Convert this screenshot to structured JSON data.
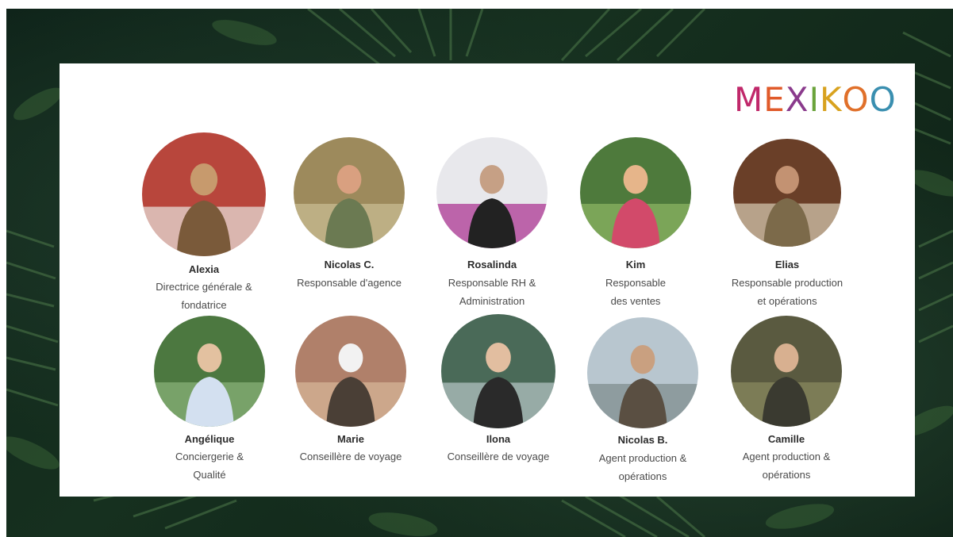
{
  "brand": {
    "logo_text": "MEXIKOO",
    "letters": [
      {
        "ch": "M",
        "color": "#c0286a"
      },
      {
        "ch": "E",
        "color": "#e05a2a"
      },
      {
        "ch": "X",
        "color": "#8a3a8c"
      },
      {
        "ch": "I",
        "color": "#6aa33a"
      },
      {
        "ch": "K",
        "color": "#d8a21f"
      },
      {
        "ch": "O",
        "color": "#e0702a"
      },
      {
        "ch": "O",
        "color": "#3a8fb0"
      }
    ]
  },
  "team": [
    {
      "name": "Alexia",
      "role_line1": "Directrice générale &",
      "role_line2": "fondatrice",
      "icon": "portrait-photo"
    },
    {
      "name": "Nicolas C.",
      "role_line1": "Responsable d'agence",
      "role_line2": "",
      "icon": "portrait-photo"
    },
    {
      "name": "Rosalinda",
      "role_line1": "Responsable RH &",
      "role_line2": "Administration",
      "icon": "portrait-photo"
    },
    {
      "name": "Kim",
      "role_line1": "Responsable",
      "role_line2": "des ventes",
      "icon": "portrait-photo"
    },
    {
      "name": "Elias",
      "role_line1": "Responsable production",
      "role_line2": "et opérations",
      "icon": "portrait-photo"
    },
    {
      "name": "Angélique",
      "role_line1": "Conciergerie &",
      "role_line2": "Qualité",
      "icon": "portrait-photo"
    },
    {
      "name": "Marie",
      "role_line1": "Conseillère de voyage",
      "role_line2": "",
      "icon": "portrait-photo"
    },
    {
      "name": "Ilona",
      "role_line1": "Conseillère de voyage",
      "role_line2": "",
      "icon": "portrait-photo"
    },
    {
      "name": "Nicolas B.",
      "role_line1": "Agent production &",
      "role_line2": "opérations",
      "icon": "portrait-photo"
    },
    {
      "name": "Camille",
      "role_line1": "Agent production &",
      "role_line2": "opérations",
      "icon": "portrait-photo"
    }
  ]
}
